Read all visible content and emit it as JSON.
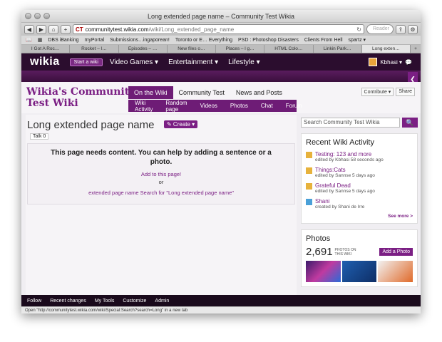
{
  "browser": {
    "window_title": "Long extended page name – Community Test Wikia",
    "url_host": "communitytest.wikia.com",
    "url_path": "/wiki/Long_extended_page_name",
    "search_placeholder": "Reader",
    "bookmarks": [
      "DBS iBanking",
      "myPortal",
      "Submissions…ingaporean!",
      "Toronto or E… Everything",
      "PSD : Photoshop Disasters",
      "Clients From Hell",
      "spartz ▾"
    ],
    "tabs": [
      "I Got A Roc…",
      "Rocket – l…",
      "Episodes – …",
      "New files o…",
      "Places – l g…",
      "HTML Colo…",
      "Linkin Park…",
      "Long exten…"
    ]
  },
  "global_nav": {
    "logo": "wikia",
    "start_wiki": "Start a wiki",
    "hubs": [
      "Video Games ▾",
      "Entertainment ▾",
      "Lifestyle ▾"
    ],
    "username": "Kbhasi ▾"
  },
  "wiki": {
    "name_line1": "Wikia's Community",
    "name_line2": "Test Wiki",
    "tabs": [
      "On the Wiki",
      "Community Test",
      "News and Posts"
    ],
    "subnav": [
      "Wiki Activity",
      "Random page",
      "Videos",
      "Photos",
      "Chat",
      "Forum"
    ],
    "contribute": "Contribute ▾",
    "share": "Share"
  },
  "page": {
    "title": "Long extended page name",
    "create": "✎ Create ▾",
    "talk": "Talk 0",
    "empty_msg": "This page needs content. You can help by adding a sentence or a photo.",
    "add_link": "Add to this page!",
    "or": "or",
    "search_link": "extended page name Search for \"Long extended page name\""
  },
  "rail": {
    "search_placeholder": "Search Community Test Wikia",
    "activity_title": "Recent Wiki Activity",
    "activity": [
      {
        "title": "Testing: 123 and more",
        "sub": "edited by Kbhasi 58 seconds ago"
      },
      {
        "title": "Things:Cats",
        "sub": "edited by Sannse 5 days ago"
      },
      {
        "title": "Grateful Dead",
        "sub": "edited by Sannse 5 days ago"
      },
      {
        "title": "Shani",
        "sub": "created by Shani de Irre"
      }
    ],
    "see_more": "See more >",
    "photos_title": "Photos",
    "photo_count": "2,691",
    "photo_label": "PHOTOS ON THIS WIKI",
    "add_photo": "Add a Photo"
  },
  "footer": {
    "items": [
      "Follow",
      "Recent changes",
      "My Tools",
      "Customize",
      "Admin"
    ]
  },
  "status": "Open \"http://communitytest.wikia.com/wiki/Special:Search?search=Long\" in a new tab"
}
